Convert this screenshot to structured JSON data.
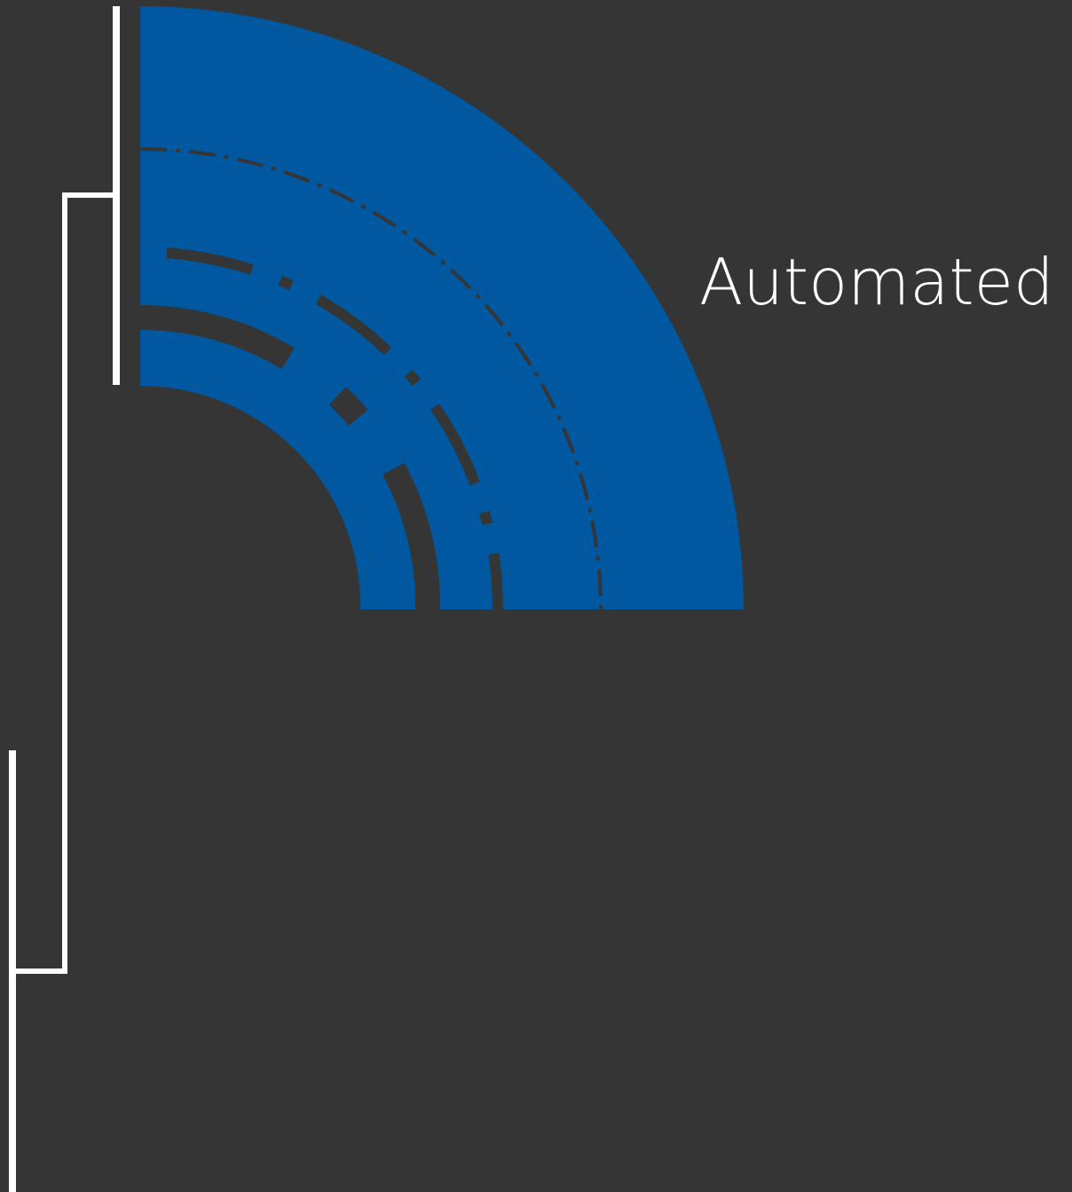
{
  "label": {
    "text": "Automated"
  },
  "colors": {
    "background": "#353535",
    "arc_fill": "#0058A0",
    "arc_rings": "#353535",
    "connectors": "#ffffff",
    "label_text": "#ffffff"
  }
}
